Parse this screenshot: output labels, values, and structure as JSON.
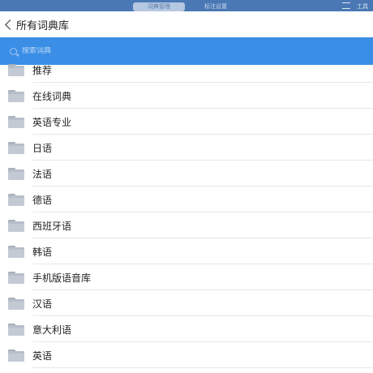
{
  "underlying_app": {
    "segment_left": "词典管理",
    "segment_right": "标注设置",
    "right_label": "工具"
  },
  "navbar": {
    "back_label": "所有词典库"
  },
  "search": {
    "placeholder": "搜索词典"
  },
  "list": {
    "items": [
      {
        "label": "推荐",
        "icon": "folder-icon"
      },
      {
        "label": "在线词典",
        "icon": "folder-icon"
      },
      {
        "label": "英语专业",
        "icon": "folder-icon"
      },
      {
        "label": "日语",
        "icon": "folder-icon"
      },
      {
        "label": "法语",
        "icon": "folder-icon"
      },
      {
        "label": "德语",
        "icon": "folder-icon"
      },
      {
        "label": "西班牙语",
        "icon": "folder-icon"
      },
      {
        "label": "韩语",
        "icon": "folder-icon"
      },
      {
        "label": "手机版语音库",
        "icon": "folder-icon"
      },
      {
        "label": "汉语",
        "icon": "folder-icon"
      },
      {
        "label": "意大利语",
        "icon": "folder-icon"
      },
      {
        "label": "英语",
        "icon": "folder-icon"
      }
    ]
  },
  "colors": {
    "search_bar": "#3a8ee6",
    "underbar": "#4a78b4",
    "folder": "#b6bec9"
  }
}
